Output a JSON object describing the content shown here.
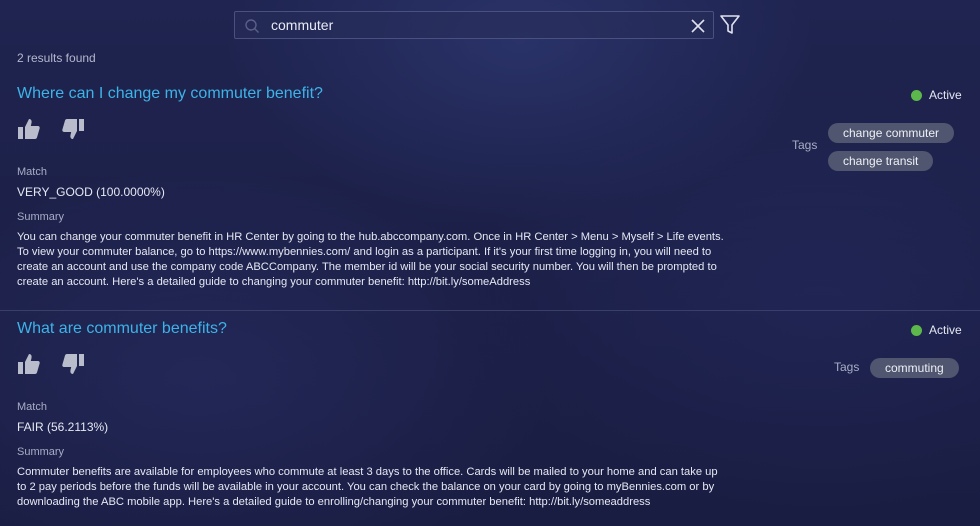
{
  "search": {
    "value": "commuter",
    "placeholder": ""
  },
  "results_count": "2 results found",
  "results": [
    {
      "title": "Where can I change my commuter benefit?",
      "status": "Active",
      "match_label": "Match",
      "match_value": "VERY_GOOD (100.0000%)",
      "summary_label": "Summary",
      "summary_lines": [
        "You can change your commuter benefit in HR Center by going to the hub.abccompany.com. Once in HR Center > Menu > Myself > Life events.",
        "To view your commuter balance, go to https://www.mybennies.com/ and login as a participant. If it's your first time logging in, you will need to",
        "create an account and use the company code ABCCompany. The member id will be your social security number. You will then be prompted to",
        "create an account. Here's a detailed guide to changing your commuter benefit: http://bit.ly/someAddress"
      ],
      "tags_label": "Tags",
      "tags": [
        "change commuter",
        "change transit"
      ]
    },
    {
      "title": "What are commuter benefits?",
      "status": "Active",
      "match_label": "Match",
      "match_value": "FAIR (56.2113%)",
      "summary_label": "Summary",
      "summary_lines": [
        "Commuter benefits are available for employees who commute at least 3 days to the office. Cards will be mailed to your home and can take up",
        "to 2 pay periods before the funds will be available in your account. You can check the balance on your card by going to myBennies.com or by",
        "downloading the ABC mobile app. Here's a detailed guide to enrolling/changing your commuter benefit: http://bit.ly/someaddress"
      ],
      "tags_label": "Tags",
      "tags": [
        "commuting"
      ]
    }
  ],
  "icons": {
    "search": "search-icon",
    "clear": "close-icon",
    "filter": "filter-icon",
    "thumbs_up": "thumbs-up-icon",
    "thumbs_down": "thumbs-down-icon",
    "status": "status-dot"
  },
  "colors": {
    "title": "#3db3e8",
    "active": "#5cb84a",
    "tag_bg": "#50566f"
  }
}
